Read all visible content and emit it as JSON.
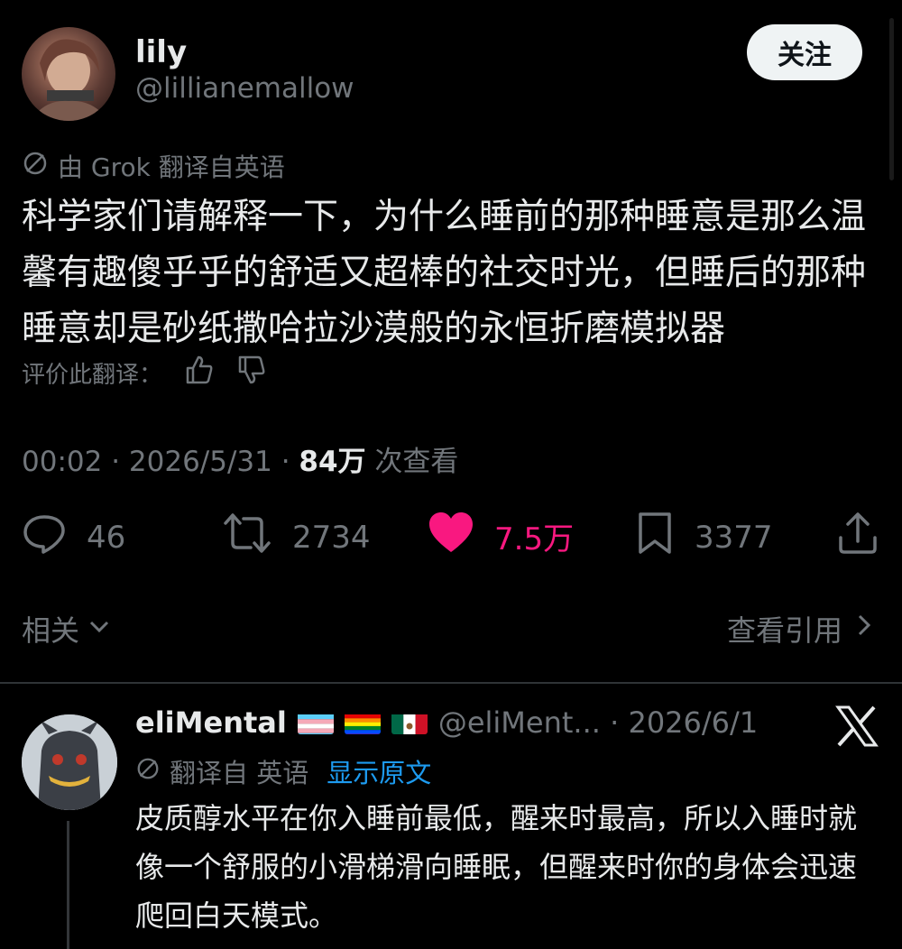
{
  "tweet": {
    "display_name": "lily",
    "handle": "@lillianemallow",
    "follow_label": "关注",
    "translated_from": "由 Grok 翻译自英语",
    "text": "科学家们请解释一下，为什么睡前的那种睡意是那么温馨有趣傻乎乎的舒适又超棒的社交时光，但睡后的那种睡意却是砂纸撒哈拉沙漠般的永恒折磨模拟器",
    "rate_label": "评价此翻译：",
    "timestamp": "00:02 · 2026/5/31 · ",
    "views_count": "84万",
    "views_suffix": " 次查看"
  },
  "actions": {
    "replies": "46",
    "retweets": "2734",
    "likes": "7.5万",
    "bookmarks": "3377"
  },
  "related_label": "相关",
  "view_quotes_label": "查看引用",
  "reply": {
    "display_name": "eliMental",
    "handle_date": "@eliMent... · 2026/6/1",
    "translated_label": "翻译自 英语",
    "show_original": "显示原文",
    "text": "皮质醇水平在你入睡前最低，醒来时最高，所以入睡时就像一个舒服的小滑梯滑向睡眠，但醒来时你的身体会迅速爬回白天模式。"
  },
  "colors": {
    "background": "#000000",
    "text": "#e7e9ea",
    "muted": "#71767b",
    "like": "#f91880",
    "link": "#1d9bf0"
  },
  "icons": [
    "reply-icon",
    "retweet-icon",
    "heart-icon",
    "bookmark-icon",
    "share-icon",
    "thumbs-up-icon",
    "thumbs-down-icon",
    "translate-icon",
    "chevron-down-icon",
    "chevron-right-icon",
    "x-logo-icon"
  ]
}
